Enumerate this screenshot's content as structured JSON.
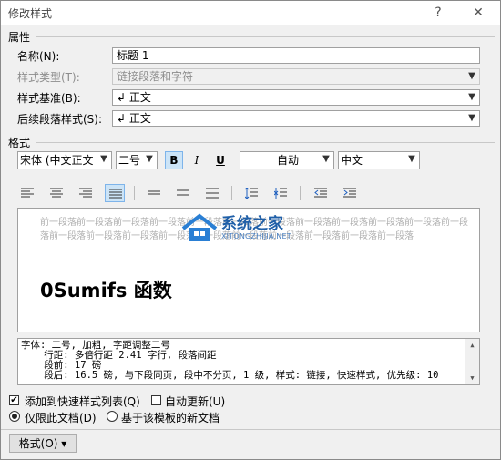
{
  "window": {
    "title": "修改样式",
    "help_label": "?",
    "close_label": "✕"
  },
  "properties": {
    "section_label": "属性",
    "name_label": "名称(N):",
    "name_value": "标题 1",
    "type_label": "样式类型(T):",
    "type_value": "链接段落和字符",
    "based_on_label": "样式基准(B):",
    "based_on_value": "↲ 正文",
    "following_label": "后续段落样式(S):",
    "following_value": "↲ 正文"
  },
  "format": {
    "section_label": "格式",
    "font": "宋体 (中文正文",
    "size": "二号",
    "bold": "B",
    "italic": "I",
    "underline": "U",
    "color": "自动",
    "language": "中文",
    "bold_active": true
  },
  "preview": {
    "previous_paragraph": "前一段落前一段落前一段落前一段落前一段落前一段落前一段落前一段落前一段落前一段落前一段落前一段落前一段落前一段落前一段落前一段落前一段落前一段落前一段落前一段落前一段落前一段落",
    "heading_text": "0Sumifs 函数"
  },
  "description": {
    "line1": "字体: 二号, 加粗, 字距调整二号",
    "line2": "    行距: 多倍行距 2.41 字行, 段落间距",
    "line3": "    段前: 17 磅",
    "line4": "    段后: 16.5 磅, 与下段同页, 段中不分页, 1 级, 样式: 链接, 快速样式, 优先级: 10"
  },
  "options": {
    "add_to_gallery": "添加到快速样式列表(Q)",
    "add_to_gallery_checked": true,
    "auto_update": "自动更新(U)",
    "auto_update_checked": false,
    "only_this_doc": "仅限此文档(D)",
    "new_docs_template": "基于该模板的新文档",
    "selected_scope": "only_this_doc"
  },
  "footer": {
    "format_button": "格式(O) ▾"
  },
  "watermark": {
    "text_cn": "系统之家",
    "text_en": "XITONGZHIJIA.NET"
  }
}
